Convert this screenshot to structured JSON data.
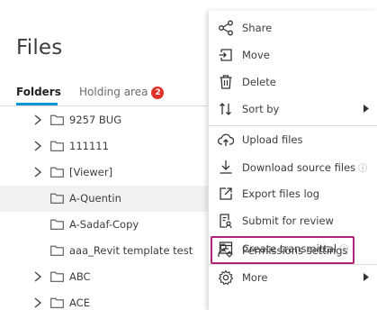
{
  "page": {
    "title": "Files"
  },
  "tabs": {
    "folders": "Folders",
    "holding_area": "Holding area",
    "holding_area_count": "2"
  },
  "colors": {
    "accent": "#0696d7",
    "badge": "#e0302a",
    "highlight": "#b2237a",
    "selected_row": "#f2f2f2"
  },
  "tree": [
    {
      "label": "9257 BUG",
      "expandable": true
    },
    {
      "label": "111111",
      "expandable": true
    },
    {
      "label": "[Viewer]",
      "expandable": true
    },
    {
      "label": "A-Quentin",
      "expandable": false,
      "selected": true
    },
    {
      "label": "A-Sadaf-Copy",
      "expandable": false
    },
    {
      "label": "aaa_Revit template test",
      "expandable": false
    },
    {
      "label": "ABC",
      "expandable": true
    },
    {
      "label": "ACE",
      "expandable": true
    }
  ],
  "menu": {
    "share": {
      "label": "Share",
      "icon": "share-icon"
    },
    "move": {
      "label": "Move",
      "icon": "move-icon"
    },
    "delete": {
      "label": "Delete",
      "icon": "trash-icon"
    },
    "sort_by": {
      "label": "Sort by",
      "icon": "sort-icon"
    },
    "upload_files": {
      "label": "Upload files",
      "icon": "cloud-upload-icon"
    },
    "download_source_files": {
      "label": "Download source files",
      "icon": "download-icon"
    },
    "export_files_log": {
      "label": "Export files log",
      "icon": "export-icon"
    },
    "submit_for_review": {
      "label": "Submit for review",
      "icon": "review-icon"
    },
    "create_transmittal": {
      "label": "Create transmittal",
      "icon": "transmittal-icon"
    },
    "permissions_settings": {
      "label": "Permissions settings",
      "icon": "permissions-icon"
    },
    "more": {
      "label": "More",
      "icon": "gear-icon"
    }
  }
}
